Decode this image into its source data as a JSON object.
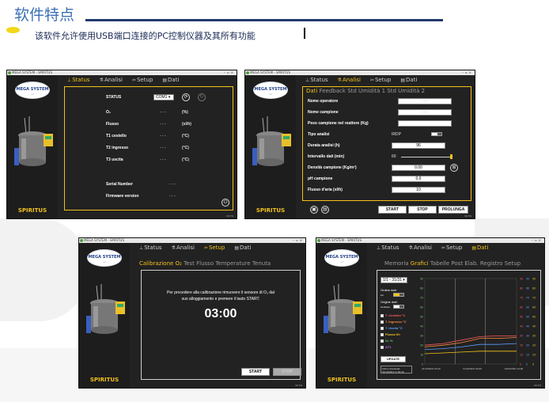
{
  "header": {
    "title": "软件特点",
    "subtitle": "该软件允许使用USB端口连接的PC控制仪器及其所有功能"
  },
  "colors": {
    "accent": "#f2c21a",
    "window_bg": "#222222",
    "title_blue": "#3b6fb6"
  },
  "app": {
    "window_title": "MEGA SYSTEM - SPIRITUS",
    "logo_text": "MEGA SYSTEM",
    "logo_sub": "srl",
    "product_name": "SPIRITUS",
    "version": "V0.7%"
  },
  "nav": {
    "status": "Status",
    "analisi": "Analisi",
    "setup": "Setup",
    "dati": "Dati"
  },
  "win1": {
    "status_label": "STATUS",
    "com_port": "COM1",
    "rows": [
      {
        "label": "O₂",
        "value": "- - -",
        "unit": "(%)"
      },
      {
        "label": "Flusso",
        "value": "- - -",
        "unit": "(sl/h)"
      },
      {
        "label": "T1 cestello",
        "value": "- - -",
        "unit": "(°C)"
      },
      {
        "label": "T2 ingresso",
        "value": "- - -",
        "unit": "(°C)"
      },
      {
        "label": "T3 uscita",
        "value": "- - -",
        "unit": "(°C)"
      }
    ],
    "serial_label": "Serial Number",
    "serial_value": "- - -",
    "firmware_label": "Firmware version",
    "firmware_value": "- - -"
  },
  "win2": {
    "subtabs": [
      "Dati",
      "Feedback",
      "Std Umidità 1",
      "Std Umidità 2"
    ],
    "rows": [
      {
        "label": "Nome operatore",
        "value": "- - -"
      },
      {
        "label": "Nome campione",
        "value": "- - -"
      },
      {
        "label": "Peso campione nel reattore (Kg)",
        "value": ""
      },
      {
        "label": "Tipo analisi",
        "value": "IRDP"
      },
      {
        "label": "Durata analisi (h)",
        "value": "96"
      },
      {
        "label": "Intervallo dati (min)",
        "value": "60"
      },
      {
        "label": "Densità campione (Kg/m³)",
        "value": "0.00"
      },
      {
        "label": "pH campione",
        "value": "0.0"
      },
      {
        "label": "Flusso d'aria (sl/h)",
        "value": "10"
      }
    ],
    "start": "START",
    "stop": "STOP",
    "prolunga": "PROLUNGA"
  },
  "win3": {
    "subtabs": [
      "Calibrazione O₂",
      "Test Flusso",
      "Temperature",
      "Tenuta"
    ],
    "message_line1": "Per procedere alla calibrazione rimuovere il sensore di O₂ dal",
    "message_line2": "suo alloggiamento e premere il tasto START.",
    "timer": "03:00",
    "start": "START",
    "stop": "STOP"
  },
  "win4": {
    "subtabs": [
      "Memoria",
      "Grafici",
      "Tabelle",
      "Post Elab.",
      "Registro Setup"
    ],
    "time_select": "1/1 - 31/31",
    "ordine_label": "Ordine dati:",
    "ordine_value": "1/n",
    "origine_label": "Origine dati:",
    "origine_value": "Continuo",
    "series": [
      {
        "name": "T. Cestello °C",
        "color": "#ff5a5a"
      },
      {
        "name": "T. Ingresso °C",
        "color": "#ff8a3a"
      },
      {
        "name": "T. Uscita °C",
        "color": "#5aa0ff"
      },
      {
        "name": "Flusso l/h",
        "color": "#f2c21a"
      },
      {
        "name": "O₂ %",
        "color": "#6ad36a"
      },
      {
        "name": "ΔT1",
        "color": "#c060e0"
      }
    ],
    "update": "UPDATE",
    "footer_label": "Ultimo download:",
    "footer_value": "01/10/2021 17:00:16",
    "x_ticks": [
      "01/10/2021 01:00",
      "01/10/2021 06:00",
      "01/10/2021 12:00"
    ],
    "y_left_ticks": [
      "90",
      "80",
      "70",
      "60",
      "50",
      "40",
      "30",
      "20",
      "10",
      "0"
    ]
  }
}
